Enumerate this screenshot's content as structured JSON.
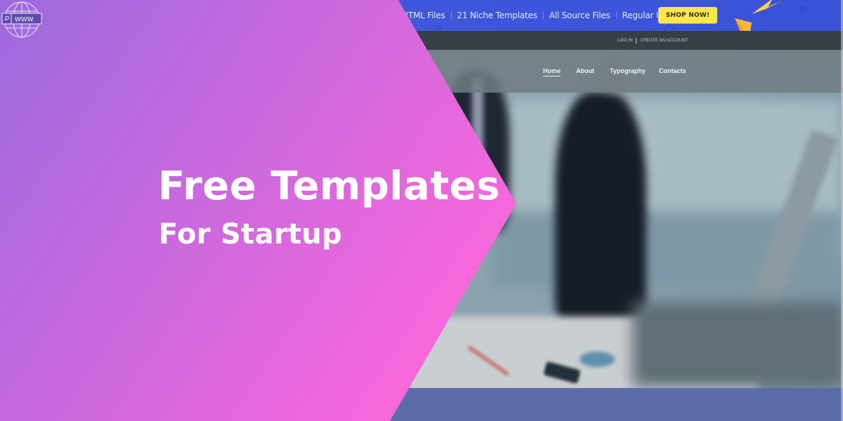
{
  "banner": {
    "headline": "Free Templates",
    "subline": "For Startup",
    "globe_icon_text": "WWW",
    "gradient_start": "#9b6ade",
    "gradient_end": "#f868dc"
  },
  "preview_site": {
    "promo_bar": {
      "items": [
        "HTML Files",
        "21 Niche Templates",
        "All Source Files",
        "Regular Updates"
      ],
      "shop_button": "SHOP NOW!",
      "background": "#3c55dc",
      "button_color": "#fde84a"
    },
    "auth_bar": {
      "login": "LOG IN",
      "create_account": "CREATE AN ACCOUNT"
    },
    "nav": {
      "items": [
        {
          "label": "Home",
          "active": true
        },
        {
          "label": "About",
          "active": false
        },
        {
          "label": "Typography",
          "active": false
        },
        {
          "label": "Contacts",
          "active": false
        }
      ]
    },
    "bottom_band_color": "#5b6ca8"
  }
}
